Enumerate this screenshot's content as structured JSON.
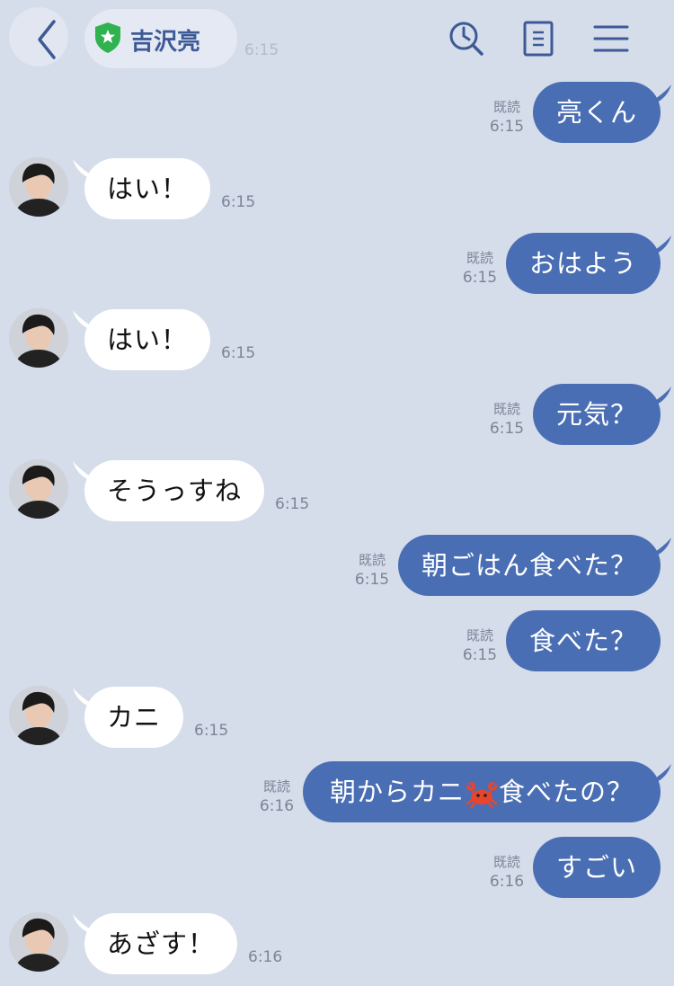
{
  "header": {
    "title": "吉沢亮",
    "ghost_time": "6:15",
    "icons": [
      "back-chevron-icon",
      "official-shield-icon",
      "search-clock-icon",
      "notes-icon",
      "menu-icon"
    ],
    "accent_color": "#3d5a96",
    "shield_color": "#2fb24f"
  },
  "colors": {
    "background": "#d5dcea",
    "my_bubble": "#4a6eb4",
    "their_bubble": "#ffffff",
    "meta_text": "#7b8699"
  },
  "messages": [
    {
      "from": "me",
      "text": "亮くん",
      "read": "既読",
      "time": "6:15"
    },
    {
      "from": "them",
      "text": "はい！",
      "time": "6:15"
    },
    {
      "from": "me",
      "text": "おはよう",
      "read": "既読",
      "time": "6:15"
    },
    {
      "from": "them",
      "text": "はい！",
      "time": "6:15"
    },
    {
      "from": "me",
      "text": "元気？",
      "read": "既読",
      "time": "6:15"
    },
    {
      "from": "them",
      "text": "そうっすね",
      "time": "6:15"
    },
    {
      "from": "me",
      "text": "朝ごはん食べた？",
      "read": "既読",
      "time": "6:15"
    },
    {
      "from": "me",
      "text": "食べた？",
      "read": "既読",
      "time": "6:15"
    },
    {
      "from": "them",
      "text": "カニ",
      "time": "6:15"
    },
    {
      "from": "me",
      "text_before": "朝からカニ",
      "emoji": "crab-emoji-icon",
      "text_after": "食べたの？",
      "read": "既読",
      "time": "6:16"
    },
    {
      "from": "me",
      "text": "すごい",
      "read": "既読",
      "time": "6:16"
    },
    {
      "from": "them",
      "text": "あざす！",
      "time": "6:16"
    }
  ]
}
